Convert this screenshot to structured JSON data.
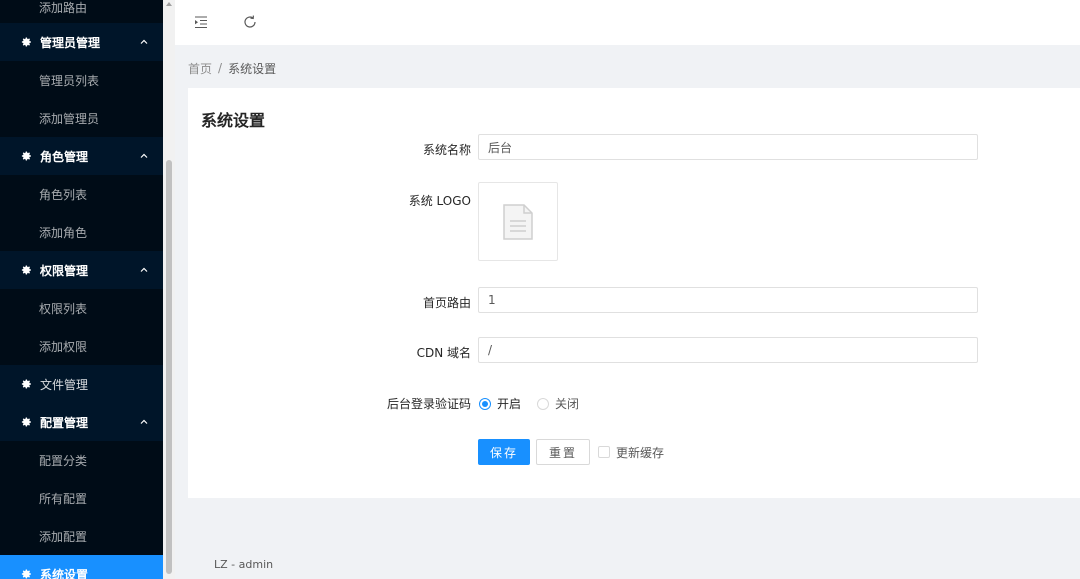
{
  "sidebar": {
    "clipped_item": "添加路由",
    "groups": [
      {
        "label": "管理员管理",
        "items": [
          "管理员列表",
          "添加管理员"
        ]
      },
      {
        "label": "角色管理",
        "items": [
          "角色列表",
          "添加角色"
        ]
      },
      {
        "label": "权限管理",
        "items": [
          "权限列表",
          "添加权限"
        ]
      },
      {
        "label": "文件管理",
        "items": []
      },
      {
        "label": "配置管理",
        "items": [
          "配置分类",
          "所有配置",
          "添加配置"
        ]
      },
      {
        "label": "系统设置",
        "items": []
      }
    ]
  },
  "header": {
    "menu_toggle_icon": "indent-icon",
    "refresh_icon": "reload-icon"
  },
  "breadcrumb": {
    "home": "首页",
    "separator": "/",
    "current": "系统设置"
  },
  "form": {
    "title": "系统设置",
    "system_name_label": "系统名称",
    "system_name_value": "后台",
    "logo_label": "系统 LOGO",
    "home_route_label": "首页路由",
    "home_route_value": "1",
    "cdn_label": "CDN 域名",
    "cdn_value": "/",
    "captcha_label": "后台登录验证码",
    "captcha_on": "开启",
    "captcha_off": "关闭",
    "save": "保存",
    "reset": "重置",
    "refresh_cache": "更新缓存"
  },
  "footer": {
    "text": "LZ - admin"
  },
  "colors": {
    "sidebar_bg": "#001529",
    "submenu_bg": "#000c17",
    "primary": "#1890ff"
  }
}
